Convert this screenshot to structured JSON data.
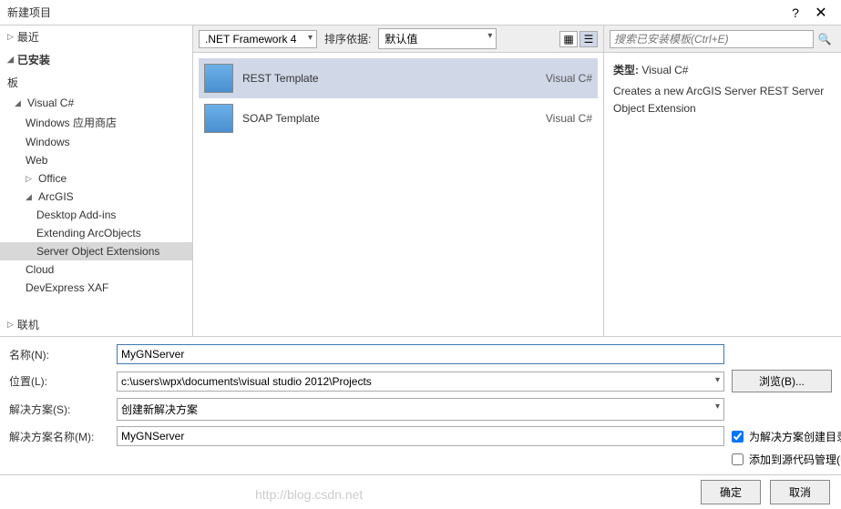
{
  "title": "新建项目",
  "nav": {
    "recent": "最近",
    "installed": "已安装",
    "group": "板",
    "items": {
      "vcs": "Visual C#",
      "winstore": "Windows 应用商店",
      "windows": "Windows",
      "web": "Web",
      "office": "Office",
      "arcgis": "ArcGIS",
      "addins": "Desktop Add-ins",
      "extend": "Extending ArcObjects",
      "soe": "Server Object Extensions",
      "cloud": "Cloud",
      "xaf": "DevExpress XAF"
    },
    "online": "联机"
  },
  "toolbar": {
    "framework": ".NET Framework 4",
    "sort_label": "排序依据:",
    "sort_value": "默认值"
  },
  "templates": [
    {
      "name": "REST Template",
      "lang": "Visual C#"
    },
    {
      "name": "SOAP Template",
      "lang": "Visual C#"
    }
  ],
  "search": {
    "placeholder": "搜索已安装模板(Ctrl+E)"
  },
  "detail": {
    "type_label": "类型:",
    "type_value": "Visual C#",
    "desc": "Creates a new ArcGIS Server REST Server Object Extension"
  },
  "form": {
    "name_label": "名称(N):",
    "name_value": "MyGNServer",
    "loc_label": "位置(L):",
    "loc_value": "c:\\users\\wpx\\documents\\visual studio 2012\\Projects",
    "browse": "浏览(B)...",
    "sln_label": "解决方案(S):",
    "sln_value": "创建新解决方案",
    "slnname_label": "解决方案名称(M):",
    "slnname_value": "MyGNServer",
    "create_dir": "为解决方案创建目录(D)",
    "add_scm": "添加到源代码管理(U)"
  },
  "buttons": {
    "ok": "确定",
    "cancel": "取消"
  },
  "watermark": "http://blog.csdn.net"
}
